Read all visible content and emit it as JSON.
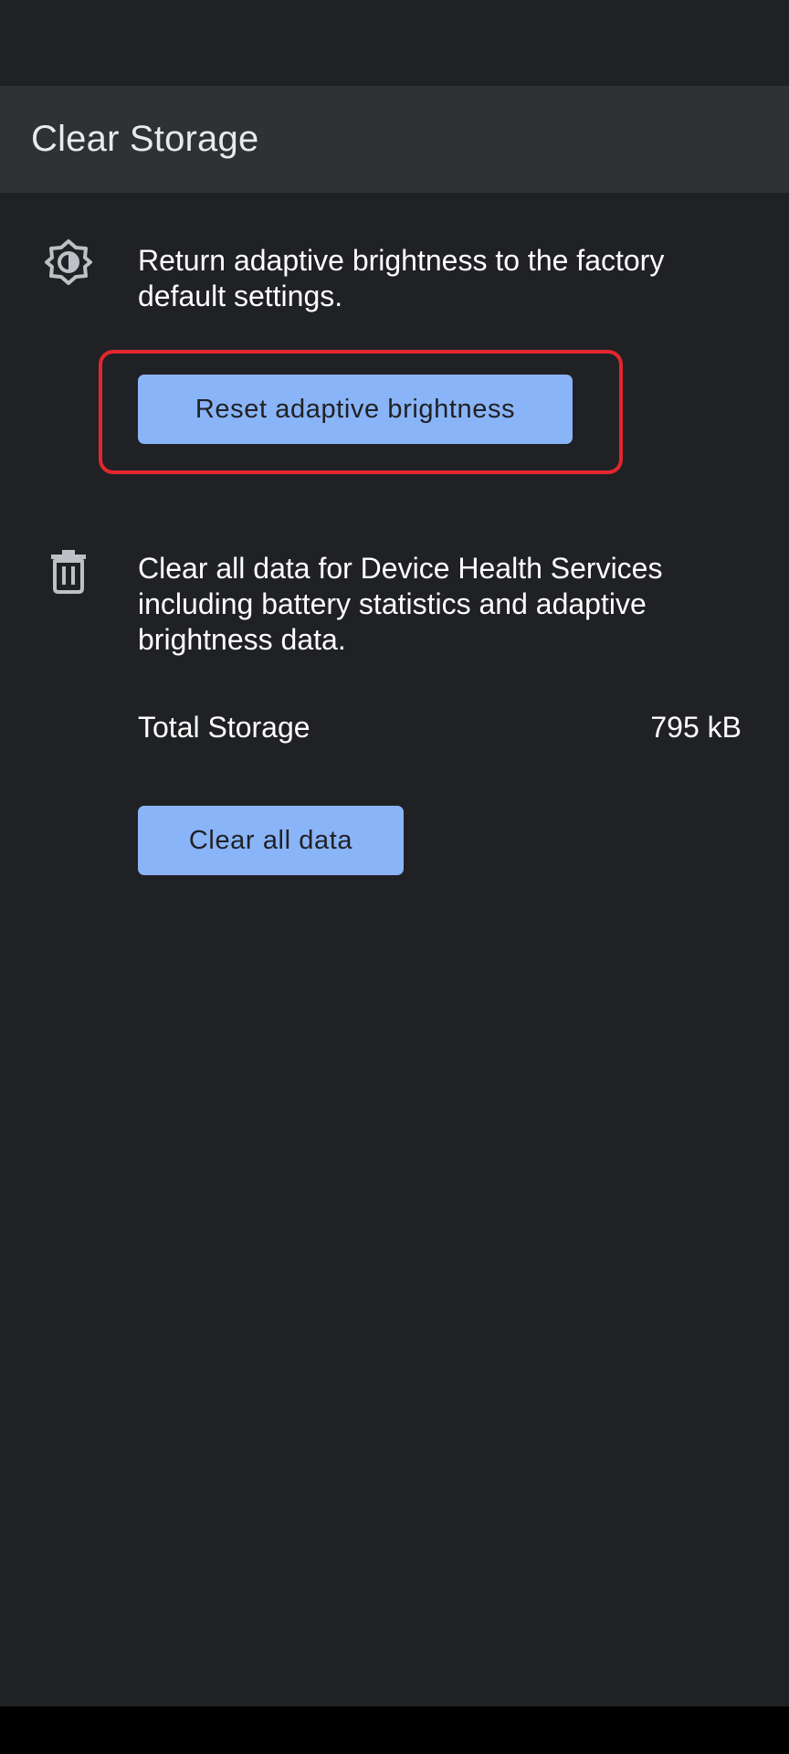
{
  "app_bar": {
    "title": "Clear Storage"
  },
  "brightness_section": {
    "icon": "brightness-icon",
    "description": "Return adaptive brightness to the factory default settings.",
    "button_label": "Reset adaptive brightness"
  },
  "data_section": {
    "icon": "trash-icon",
    "description": "Clear all data for Device Health Services including battery statistics and adaptive brightness data.",
    "storage_label": "Total Storage",
    "storage_value": "795 kB",
    "button_label": "Clear all data"
  },
  "colors": {
    "background": "#202124",
    "app_bar": "#303134",
    "button": "#8ab4f8",
    "highlight": "#e3262f"
  }
}
